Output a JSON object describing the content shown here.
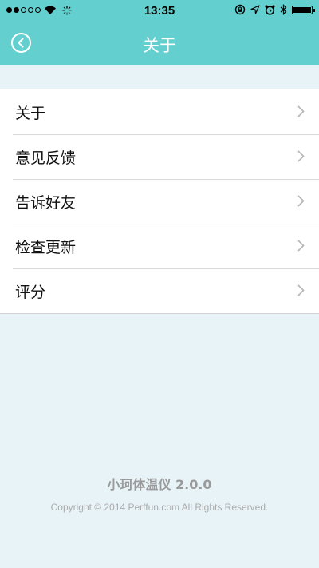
{
  "status_bar": {
    "signal_bars_filled": 2,
    "signal_bars_total": 5,
    "time": "13:35",
    "battery_level": 1.0,
    "icons": [
      "wifi-icon",
      "activity-spinner-icon",
      "rotation-lock-icon",
      "location-icon",
      "alarm-icon",
      "bluetooth-icon",
      "battery-icon"
    ]
  },
  "nav": {
    "title": "关于",
    "back_icon": "back-circle-icon"
  },
  "menu": {
    "items": [
      {
        "label": "关于"
      },
      {
        "label": "意见反馈"
      },
      {
        "label": "告诉好友"
      },
      {
        "label": "检查更新"
      },
      {
        "label": "评分"
      }
    ],
    "chevron_icon": "chevron-right-icon"
  },
  "footer": {
    "app_version": "小珂体温仪 2.0.0",
    "copyright": "Copyright © 2014 Perffun.com All Rights Reserved."
  },
  "colors": {
    "header": "#63d0cf",
    "background": "#e8f3f8",
    "list_background": "#ffffff",
    "footer_text": "#9a9a9a"
  }
}
